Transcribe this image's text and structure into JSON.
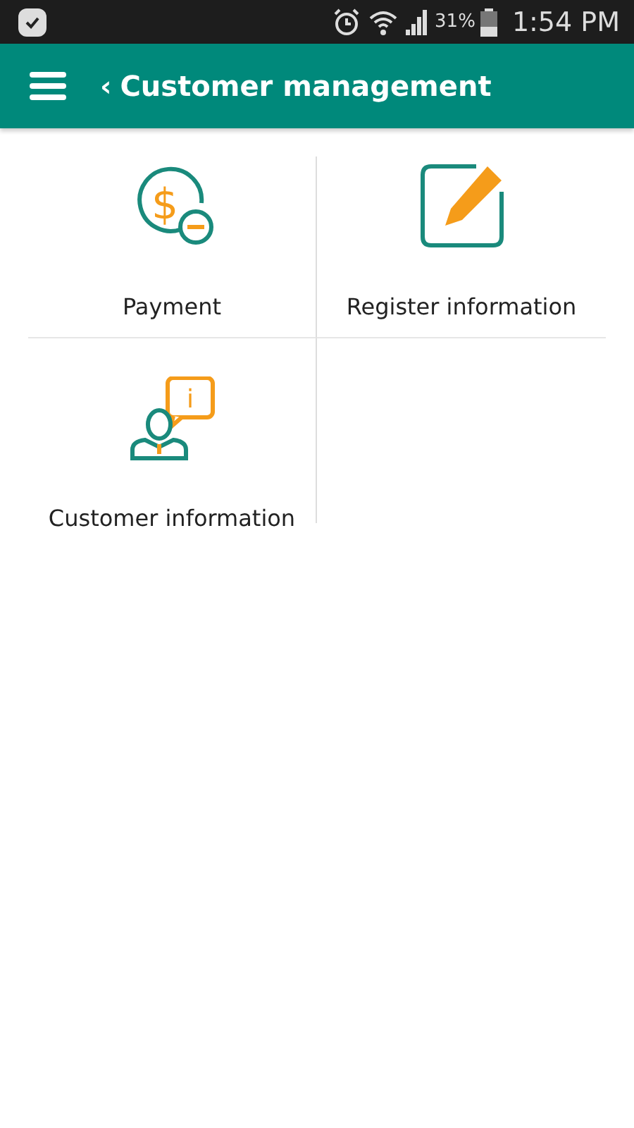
{
  "status_bar": {
    "battery_percent": "31%",
    "time": "1:54 PM"
  },
  "app_bar": {
    "back_glyph": "‹",
    "title": "Customer management"
  },
  "tiles": [
    {
      "kind": "payment",
      "label": "Payment",
      "glyph": "$"
    },
    {
      "kind": "edit",
      "label": "Register information"
    },
    {
      "kind": "customer",
      "label": "Customer information",
      "glyph": "i"
    }
  ]
}
